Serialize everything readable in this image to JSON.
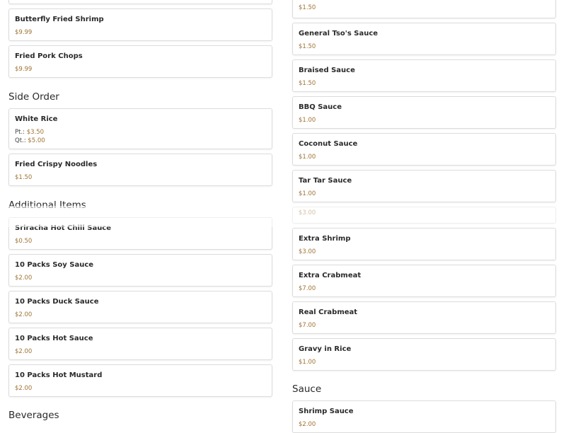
{
  "left": {
    "top_items": [
      {
        "name": "Butterfly Fried Shrimp",
        "price": "$9.99"
      },
      {
        "name": "Fried Pork Chops",
        "price": "$9.99"
      }
    ],
    "side_order": {
      "title": "Side Order",
      "white_rice": {
        "name": "White Rice",
        "pt_label": "Pt.:",
        "pt_price": "$3.50",
        "qt_label": "Qt.:",
        "qt_price": "$5.00"
      },
      "fried_noodles": {
        "name": "Fried Crispy Noodles",
        "price": "$1.50"
      }
    },
    "additional": {
      "title": "Additional Items",
      "items": [
        {
          "name": "Sriracha Hot Chili Sauce",
          "price": "$0.50"
        },
        {
          "name": "10 Packs Soy Sauce",
          "price": "$2.00"
        },
        {
          "name": "10 Packs Duck Sauce",
          "price": "$2.00"
        },
        {
          "name": "10 Packs Hot Sauce",
          "price": "$2.00"
        },
        {
          "name": "10 Packs Hot Mustard",
          "price": "$2.00"
        }
      ]
    },
    "beverages_title": "Beverages"
  },
  "right": {
    "partial_price": "$1.50",
    "sauces": [
      {
        "name": "General Tso's Sauce",
        "price": "$1.50"
      },
      {
        "name": "Braised Sauce",
        "price": "$1.50"
      },
      {
        "name": "BBQ Sauce",
        "price": "$1.00"
      },
      {
        "name": "Coconut Sauce",
        "price": "$1.00"
      },
      {
        "name": "Tar Tar Sauce",
        "price": "$1.00"
      }
    ],
    "partial_price2": "$3.00",
    "extras": [
      {
        "name": "Extra Shrimp",
        "price": "$3.00"
      },
      {
        "name": "Extra Crabmeat",
        "price": "$7.00"
      },
      {
        "name": "Real Crabmeat",
        "price": "$7.00"
      },
      {
        "name": "Gravy in Rice",
        "price": "$1.00"
      }
    ],
    "sauce_section": {
      "title": "Sauce",
      "items": [
        {
          "name": "Shrimp Sauce",
          "price": "$2.00"
        }
      ]
    }
  }
}
